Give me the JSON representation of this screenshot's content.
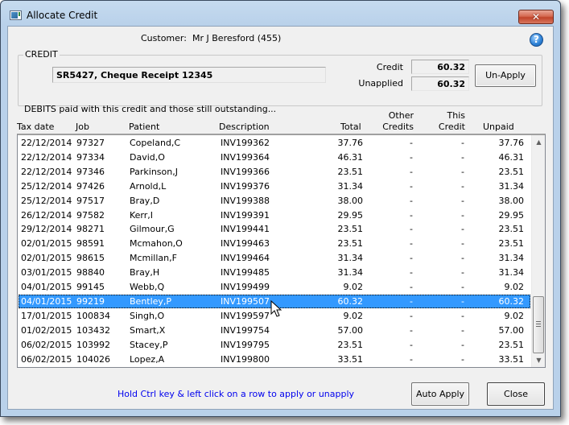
{
  "window": {
    "title": "Allocate Credit",
    "close_glyph": "✕",
    "icon": "app-window-icon"
  },
  "header": {
    "customer_label": "Customer:",
    "customer_value": "Mr J Beresford (455)",
    "help_glyph": "?"
  },
  "credit": {
    "group_label": "CREDIT",
    "reference": "SR5427, Cheque Receipt  12345",
    "credit_label": "Credit",
    "credit_value": "60.32",
    "unapplied_label": "Unapplied",
    "unapplied_value": "60.32",
    "unapply_button": "Un-Apply"
  },
  "debits": {
    "caption": "DEBITS paid with this credit and those still outstanding...",
    "columns": {
      "tax_date": "Tax date",
      "job": "Job",
      "patient": "Patient",
      "description": "Description",
      "total": "Total",
      "other_credits_1": "Other",
      "other_credits_2": "Credits",
      "this_credit_1": "This",
      "this_credit_2": "Credit",
      "unpaid": "Unpaid"
    },
    "selected_index": 11,
    "rows": [
      {
        "date": "22/12/2014",
        "job": "97327",
        "patient": "Copeland,C",
        "desc": "INV199362",
        "total": "37.76",
        "other": "-",
        "this": "-",
        "unpaid": "37.76"
      },
      {
        "date": "22/12/2014",
        "job": "97334",
        "patient": "David,O",
        "desc": "INV199364",
        "total": "46.31",
        "other": "-",
        "this": "-",
        "unpaid": "46.31"
      },
      {
        "date": "22/12/2014",
        "job": "97346",
        "patient": "Parkinson,J",
        "desc": "INV199366",
        "total": "23.51",
        "other": "-",
        "this": "-",
        "unpaid": "23.51"
      },
      {
        "date": "25/12/2014",
        "job": "97426",
        "patient": "Arnold,L",
        "desc": "INV199376",
        "total": "31.34",
        "other": "-",
        "this": "-",
        "unpaid": "31.34"
      },
      {
        "date": "25/12/2014",
        "job": "97517",
        "patient": "Bray,D",
        "desc": "INV199388",
        "total": "38.00",
        "other": "-",
        "this": "-",
        "unpaid": "38.00"
      },
      {
        "date": "26/12/2014",
        "job": "97582",
        "patient": "Kerr,I",
        "desc": "INV199391",
        "total": "29.95",
        "other": "-",
        "this": "-",
        "unpaid": "29.95"
      },
      {
        "date": "29/12/2014",
        "job": "98271",
        "patient": "Gilmour,G",
        "desc": "INV199441",
        "total": "23.51",
        "other": "-",
        "this": "-",
        "unpaid": "23.51"
      },
      {
        "date": "02/01/2015",
        "job": "98591",
        "patient": "Mcmahon,O",
        "desc": "INV199463",
        "total": "23.51",
        "other": "-",
        "this": "-",
        "unpaid": "23.51"
      },
      {
        "date": "02/01/2015",
        "job": "98615",
        "patient": "Mcmillan,F",
        "desc": "INV199464",
        "total": "31.34",
        "other": "-",
        "this": "-",
        "unpaid": "31.34"
      },
      {
        "date": "03/01/2015",
        "job": "98840",
        "patient": "Bray,H",
        "desc": "INV199485",
        "total": "31.34",
        "other": "-",
        "this": "-",
        "unpaid": "31.34"
      },
      {
        "date": "04/01/2015",
        "job": "99145",
        "patient": "Webb,Q",
        "desc": "INV199499",
        "total": "9.02",
        "other": "-",
        "this": "-",
        "unpaid": "9.02"
      },
      {
        "date": "04/01/2015",
        "job": "99219",
        "patient": "Bentley,P",
        "desc": "INV199507",
        "total": "60.32",
        "other": "-",
        "this": "-",
        "unpaid": "60.32"
      },
      {
        "date": "17/01/2015",
        "job": "100834",
        "patient": "Singh,O",
        "desc": "INV199597",
        "total": "9.02",
        "other": "-",
        "this": "-",
        "unpaid": "9.02"
      },
      {
        "date": "01/02/2015",
        "job": "103432",
        "patient": "Smart,X",
        "desc": "INV199754",
        "total": "57.00",
        "other": "-",
        "this": "-",
        "unpaid": "57.00"
      },
      {
        "date": "06/02/2015",
        "job": "103992",
        "patient": "Stacey,P",
        "desc": "INV199795",
        "total": "23.51",
        "other": "-",
        "this": "-",
        "unpaid": "23.51"
      },
      {
        "date": "06/02/2015",
        "job": "104026",
        "patient": "Lopez,A",
        "desc": "INV199800",
        "total": "33.51",
        "other": "-",
        "this": "-",
        "unpaid": "33.51"
      }
    ],
    "scroll_up_glyph": "▲",
    "scroll_down_glyph": "▼"
  },
  "footer": {
    "hint": "Hold Ctrl key & left click on a row to apply or unapply",
    "hint_color": "#0000ee",
    "auto_apply_button": "Auto Apply",
    "close_button": "Close"
  },
  "colors": {
    "selection": "#3399ff",
    "frame": "#b9d1ea",
    "close_button": "#c1442a"
  }
}
